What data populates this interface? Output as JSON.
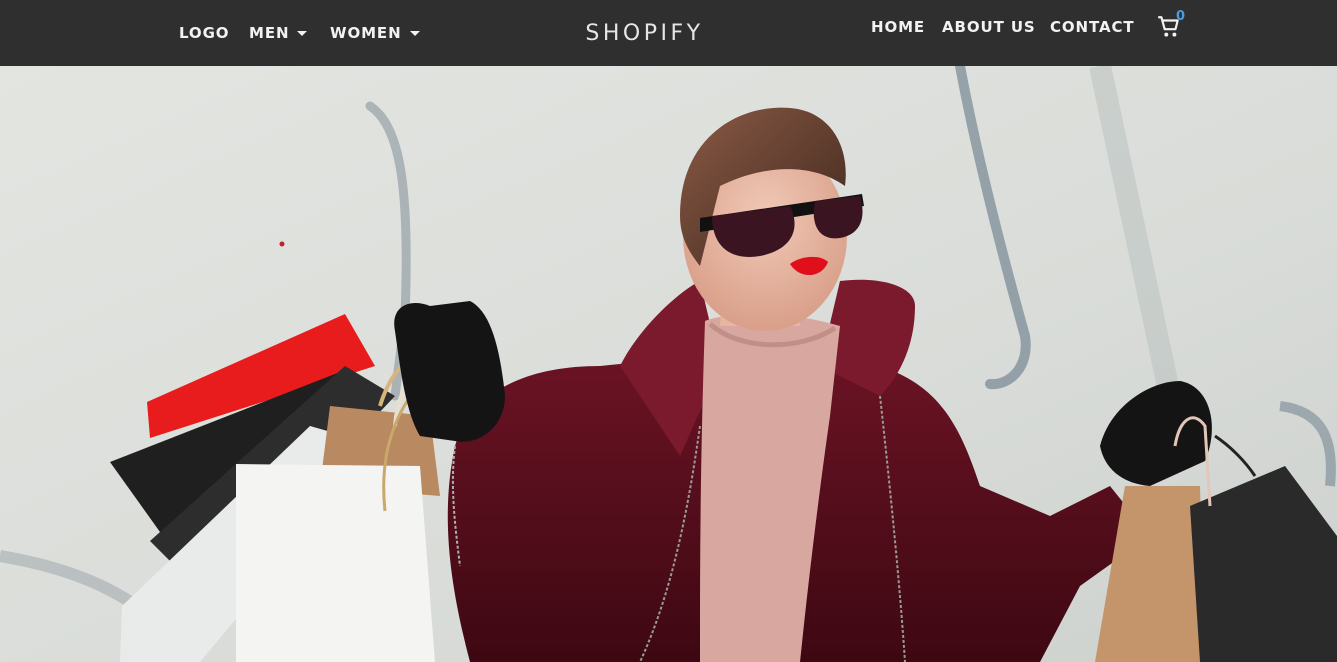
{
  "nav": {
    "logo": "LOGO",
    "men": "MEN",
    "women": "WOMEN",
    "brand": "SHOPIFY",
    "home": "HOME",
    "about": "ABOUT US",
    "contact": "CONTACT",
    "cart_count": "0"
  },
  "icons": {
    "cart": "shopping-cart-icon",
    "dropdown": "caret-down-icon"
  },
  "colors": {
    "navbar_bg": "#2f2f2f",
    "nav_text": "#f2f2f2",
    "cart_badge": "#4a9de0"
  }
}
